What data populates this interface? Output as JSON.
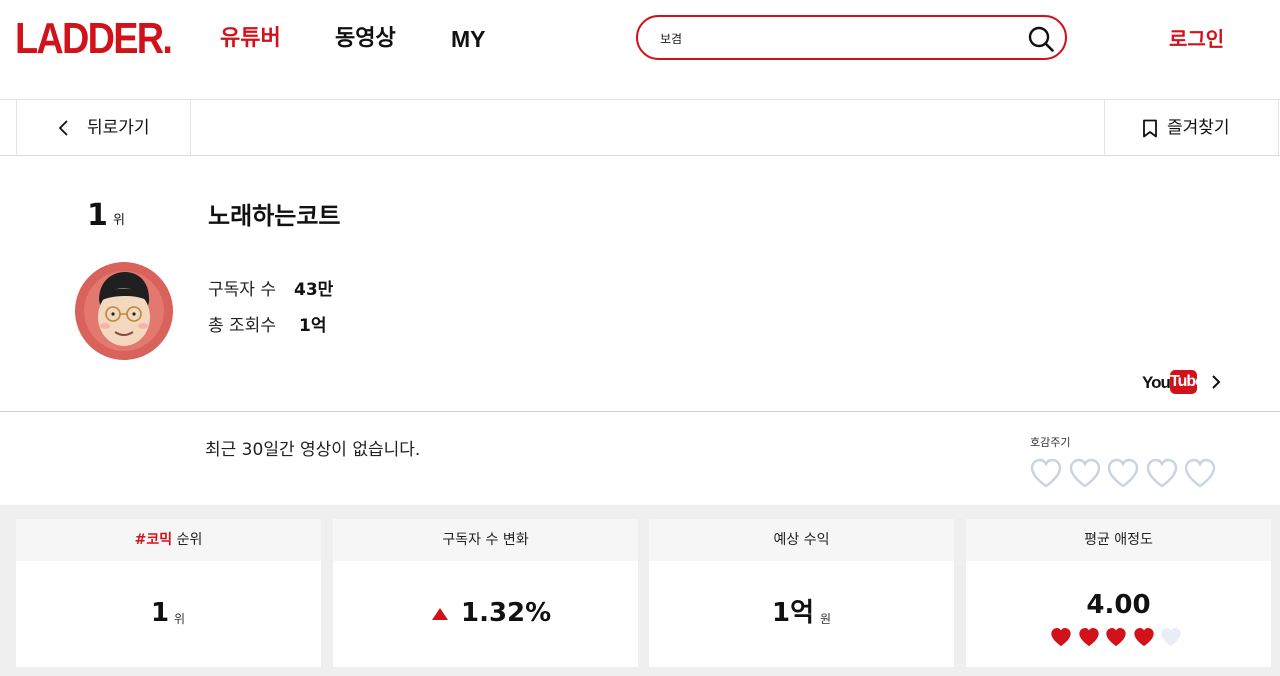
{
  "header": {
    "logo": "LADDER.",
    "nav": {
      "youtuber": "유튜버",
      "video": "동영상",
      "my": "MY"
    },
    "search": {
      "value": "보겸",
      "placeholder": ""
    },
    "login": "로그인"
  },
  "subbar": {
    "back_label": "뒤로가기",
    "bookmark_label": "즐겨찾기"
  },
  "profile": {
    "rank": "1",
    "rank_unit": "위",
    "channel_name": "노래하는코트",
    "subscribers_label": "구독자 수",
    "subscribers_value": "43만",
    "views_label": "총 조회수",
    "views_value": "1억",
    "youtube_logo": {
      "you": "You",
      "tube": "Tube"
    }
  },
  "videos": {
    "empty_message": "최근 30일간 영상이 없습니다.",
    "like_label": "호감주기",
    "like_hearts": 5
  },
  "cards": {
    "category_rank": {
      "tag": "#코믹",
      "label": " 순위",
      "value": "1",
      "unit": "위"
    },
    "sub_change": {
      "label": "구독자 수 변화",
      "direction": "up",
      "value": "1.32%"
    },
    "revenue": {
      "label": "예상 수익",
      "value": "1억",
      "unit": "원"
    },
    "affinity": {
      "label": "평균 애정도",
      "value": "4.00",
      "hearts_filled": 4,
      "hearts_total": 5
    }
  },
  "colors": {
    "brand": "#d2121b",
    "heart_empty_outline": "#c8d3e6",
    "heart_empty_fill": "#e9eef6"
  }
}
